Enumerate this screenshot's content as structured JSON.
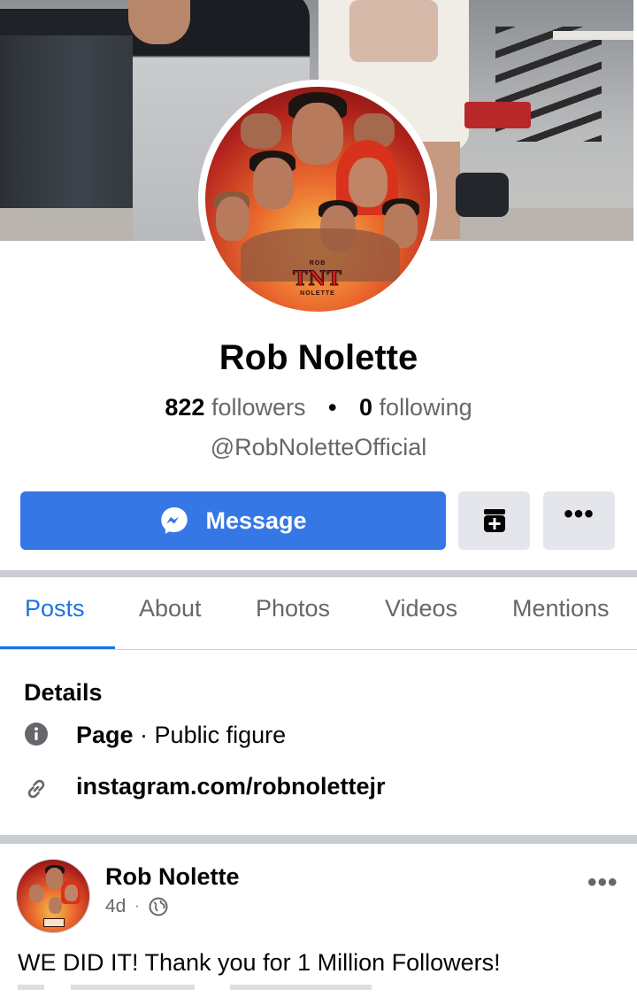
{
  "profile": {
    "name": "Rob Nolette",
    "followers_count": "822",
    "followers_label": "followers",
    "stats_separator": "•",
    "following_count": "0",
    "following_label": "following",
    "handle": "@RobNoletteOfficial",
    "avatar_logo": {
      "top": "ROB",
      "main": "TNT",
      "bottom": "NOLETTE"
    }
  },
  "actions": {
    "message_label": "Message",
    "message_icon": "messenger-icon",
    "save_icon": "save-plus-icon",
    "more_label": "•••",
    "message_color": "#3578e5"
  },
  "tabs": [
    {
      "label": "Posts",
      "active": true
    },
    {
      "label": "About",
      "active": false
    },
    {
      "label": "Photos",
      "active": false
    },
    {
      "label": "Videos",
      "active": false
    },
    {
      "label": "Mentions",
      "active": false
    }
  ],
  "details": {
    "title": "Details",
    "page_type_bold": "Page",
    "page_type_rest": " · Public figure",
    "page_icon": "info-icon",
    "link": "instagram.com/robnolettejr",
    "link_icon": "link-icon"
  },
  "post": {
    "author": "Rob Nolette",
    "time": "4d",
    "meta_separator": "·",
    "audience_icon": "globe-icon",
    "more_label": "•••",
    "text": "WE DID IT! Thank you for 1 Million Followers!"
  },
  "colors": {
    "accent": "#1b74e4",
    "secondary_text": "#65676b",
    "button_grey": "#e4e6eb",
    "separator": "#c9ccd1"
  }
}
